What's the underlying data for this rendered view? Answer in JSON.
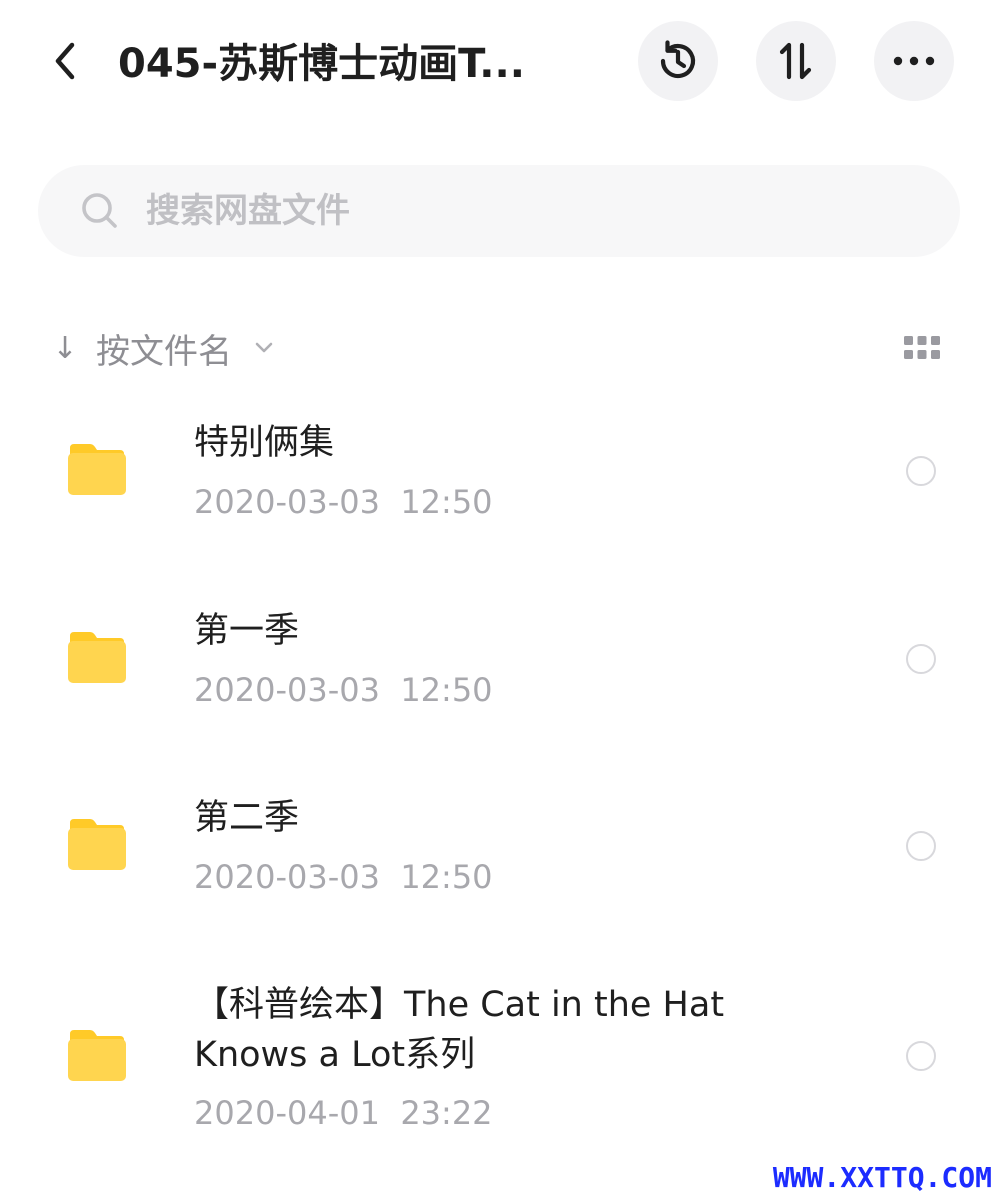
{
  "header": {
    "title": "045-苏斯博士动画T...",
    "back_icon": "back-chevron-icon",
    "history_icon": "history-icon",
    "sort_icon": "sort-updown-icon",
    "more_icon": "more-dots-icon"
  },
  "search": {
    "placeholder": "搜索网盘文件",
    "value": ""
  },
  "sort_bar": {
    "arrow": "↓",
    "label": "按文件名",
    "view_icon": "grid-view-icon"
  },
  "files": [
    {
      "name": "特别俩集",
      "date": "2020-03-03  12:50",
      "type": "folder"
    },
    {
      "name": "第一季",
      "date": "2020-03-03  12:50",
      "type": "folder"
    },
    {
      "name": "第二季",
      "date": "2020-03-03  12:50",
      "type": "folder"
    },
    {
      "name": "【科普绘本】The Cat in the Hat Knows a Lot系列",
      "date": "2020-04-01  23:22",
      "type": "folder"
    }
  ],
  "watermark": "WWW.XXTTQ.COM",
  "colors": {
    "folder": "#ffd54a",
    "folder_tab": "#ffcb2e",
    "muted_text": "#a8a8ad",
    "button_bg": "#f2f2f4",
    "search_bg": "#f7f7f8",
    "watermark": "#1c2cff"
  }
}
